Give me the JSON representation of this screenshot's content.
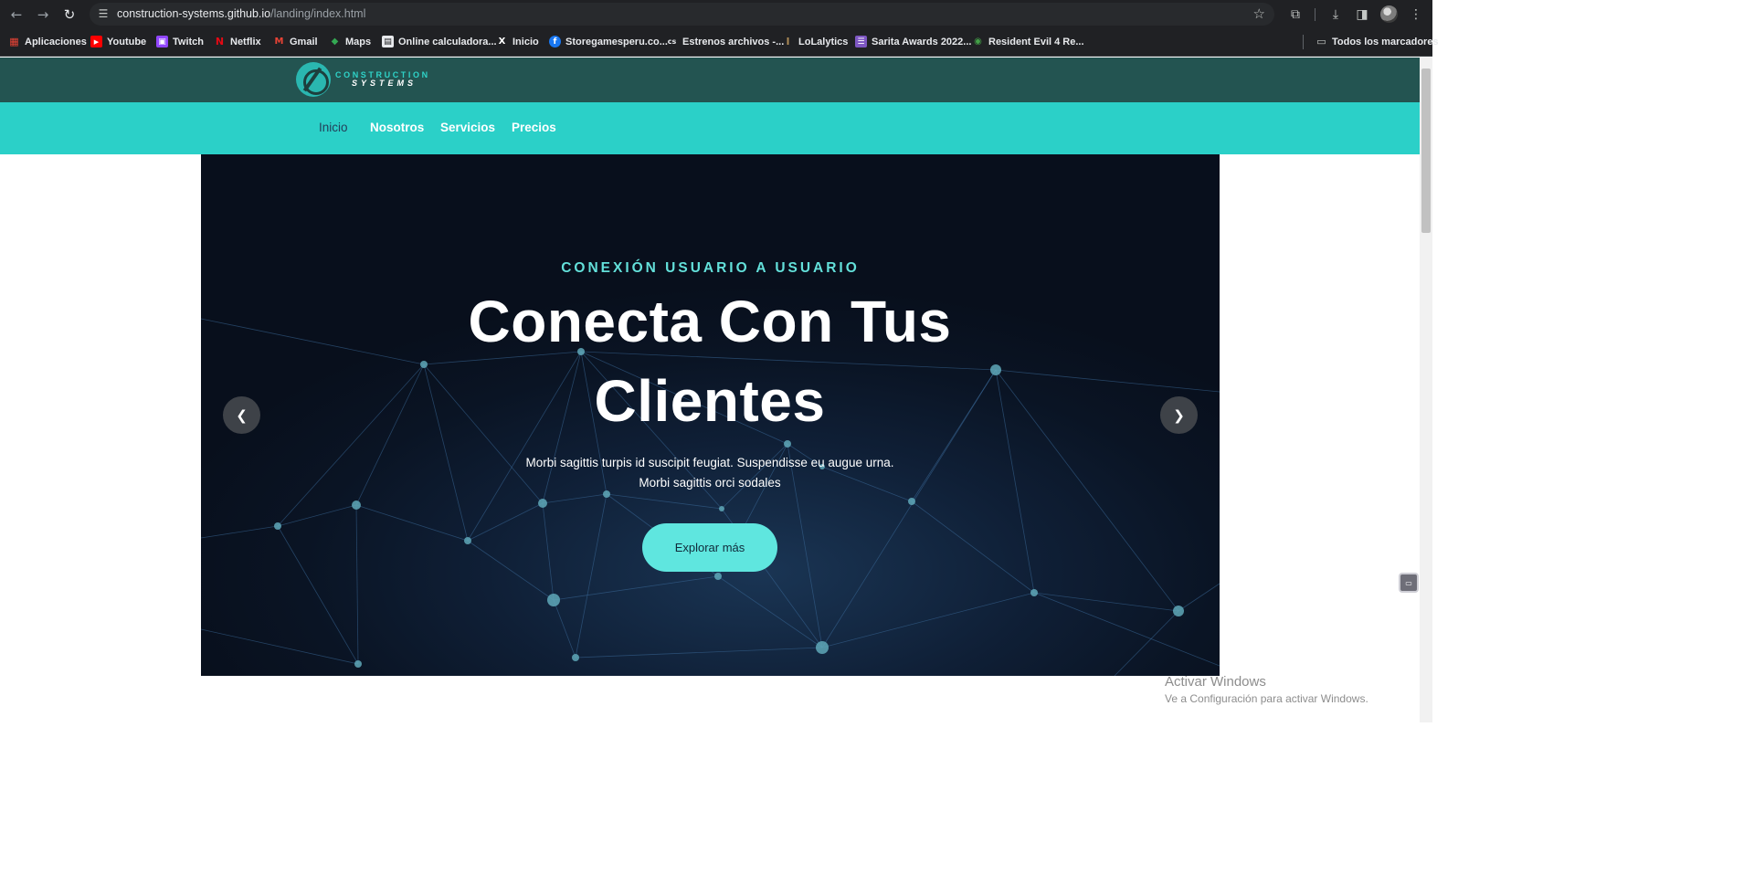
{
  "browser": {
    "url_host": "construction-systems.github.io",
    "url_path": "/landing/index.html",
    "icons": [
      "back-icon",
      "forward-icon",
      "reload-icon",
      "site-info-icon",
      "bookmark-star-icon",
      "extensions-icon",
      "downloads-icon",
      "side-panel-icon",
      "profile-avatar",
      "menu-icon"
    ],
    "glyphs": {
      "back": "←",
      "forward": "→",
      "reload": "↻",
      "site": "☰",
      "star": "☆",
      "ext": "⧉",
      "download": "⤓",
      "panel": "◨",
      "menu": "⋮",
      "folder": "▭"
    }
  },
  "bookmarks": {
    "items": [
      {
        "label": "Aplicaciones",
        "glyph": "▦",
        "color": "#ea4335"
      },
      {
        "label": "Youtube",
        "glyph": "▶",
        "color": "#ff0000"
      },
      {
        "label": "Twitch",
        "glyph": "▣",
        "color": "#9146ff"
      },
      {
        "label": "Netflix",
        "glyph": "N",
        "color": "#e50914"
      },
      {
        "label": "Gmail",
        "glyph": "M",
        "color": "#ea4335"
      },
      {
        "label": "Maps",
        "glyph": "◆",
        "color": "#34a853"
      },
      {
        "label": "Online calculadora...",
        "glyph": "▤",
        "color": "#5f6368"
      },
      {
        "label": "Inicio",
        "glyph": "X",
        "color": "#000000"
      },
      {
        "label": "Storegamesperu.co...",
        "glyph": "f",
        "color": "#1877f2"
      },
      {
        "label": "Estrenos archivos -...",
        "glyph": "cs",
        "color": "#111111"
      },
      {
        "label": "LoLalytics",
        "glyph": "l",
        "color": "#b08d57"
      },
      {
        "label": "Sarita Awards 2022...",
        "glyph": "☰",
        "color": "#7e57c2"
      },
      {
        "label": "Resident Evil 4 Re...",
        "glyph": "◉",
        "color": "#2e7d32"
      }
    ],
    "all_bookmarks": "Todos los marcadores"
  },
  "site": {
    "logo": {
      "line1": "CONSTRUCTION",
      "line2": "SYSTEMS"
    },
    "nav": [
      "Inicio",
      "Nosotros",
      "Servicios",
      "Precios"
    ],
    "nav_current": "Inicio"
  },
  "hero": {
    "eyebrow": "CONEXIÓN USUARIO A USUARIO",
    "title": "Conecta Con Tus Clientes",
    "text": "Morbi sagittis turpis id suscipit feugiat. Suspendisse eu augue urna. Morbi sagittis orci sodales",
    "button": "Explorar más",
    "prev_glyph": "❮",
    "next_glyph": "❯"
  },
  "windows_watermark": {
    "line1": "Activar Windows",
    "line2": "Ve a Configuración para activar Windows."
  },
  "colors": {
    "header_bg": "#235451",
    "nav_bg": "#2bd0c8",
    "accent": "#63e0da",
    "button_bg": "#5fe6df",
    "hero_bg": "#0a1424"
  }
}
